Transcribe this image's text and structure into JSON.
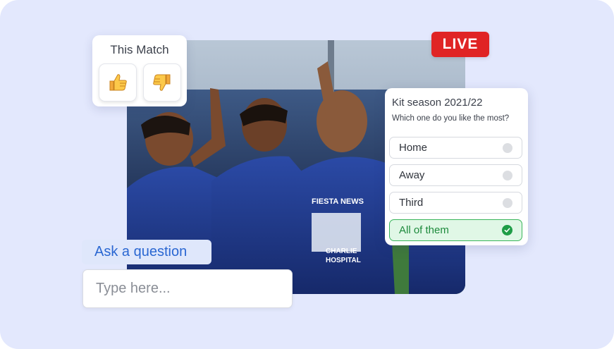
{
  "live_badge": "LIVE",
  "match_reaction": {
    "title": "This Match",
    "buttons": [
      {
        "icon": "thumbs-up-icon"
      },
      {
        "icon": "thumbs-down-icon"
      }
    ]
  },
  "poll": {
    "title": "Kit season 2021/22",
    "question": "Which one do you like the most?",
    "options": [
      {
        "label": "Home",
        "selected": false
      },
      {
        "label": "Away",
        "selected": false
      },
      {
        "label": "Third",
        "selected": false
      },
      {
        "label": "All of them",
        "selected": true
      }
    ],
    "selected_color": "#1f9d47"
  },
  "question": {
    "tag": "Ask a question",
    "placeholder": "Type here..."
  },
  "photo": {
    "jersey_text": [
      "FIESTA NEWS",
      "CHARLIE",
      "HOSPITAL"
    ]
  },
  "colors": {
    "background": "#e3e8fd",
    "live": "#e02424",
    "accent_blue": "#2a67d2"
  }
}
